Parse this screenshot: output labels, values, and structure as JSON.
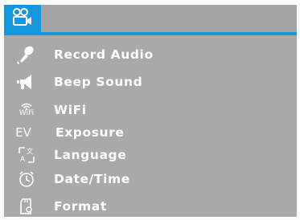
{
  "header": {
    "mode_icon": "video-camera-icon",
    "accent_color": "#1696dc"
  },
  "menu": {
    "items": [
      {
        "label": "Record Audio",
        "icon": "microphone-icon"
      },
      {
        "label": "Beep Sound",
        "icon": "speaker-icon"
      },
      {
        "label": "WiFi",
        "icon": "wifi-icon",
        "icon_text": "WiFi"
      },
      {
        "label": "Exposure",
        "icon": "exposure-icon",
        "icon_text": "EV"
      },
      {
        "label": "Language",
        "icon": "language-icon"
      },
      {
        "label": "Date/Time",
        "icon": "clock-icon"
      },
      {
        "label": "Format",
        "icon": "sd-card-icon"
      }
    ]
  }
}
